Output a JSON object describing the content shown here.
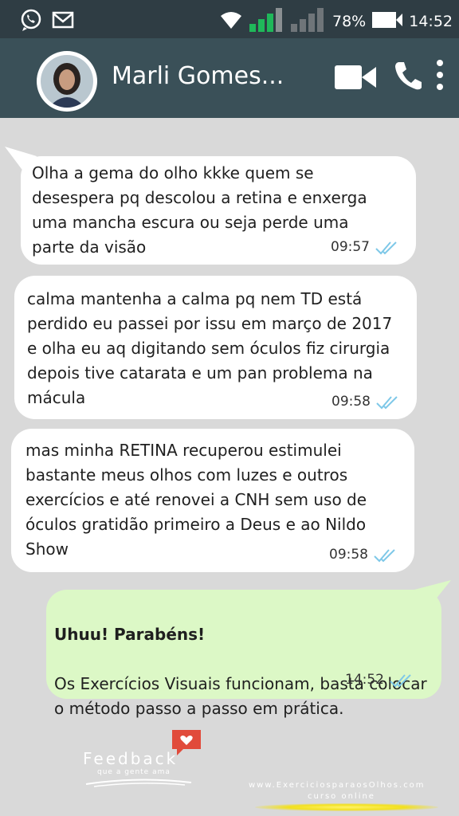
{
  "status_bar": {
    "left_icons": [
      "whatsapp-icon",
      "mail-icon"
    ],
    "battery_percent": "78%",
    "time": "14:52"
  },
  "header": {
    "contact_name": "Marli Gomes...",
    "icons": [
      "video-call-icon",
      "phone-icon",
      "more-vert-icon"
    ]
  },
  "messages": [
    {
      "direction": "incoming",
      "text": "Olha a gema do olho kkke quem se\ndesespera pq descolou a retina e enxerga\numa mancha escura ou seja perde uma\nparte da visão",
      "time": "09:57"
    },
    {
      "direction": "incoming",
      "text": "calma mantenha a calma pq nem TD está\nperdido eu passei por issu em março de 2017\ne olha eu aq digitando sem óculos fiz cirurgia\ndepois tive catarata e um pan problema na\nmácula",
      "time": "09:58"
    },
    {
      "direction": "incoming",
      "text": "mas minha RETINA recuperou estimulei\nbastante meus olhos com luzes e outros\nexercícios e até renovei a CNH sem uso de\nóculos gratidão primeiro a Deus e ao Nildo\nShow",
      "time": "09:58"
    },
    {
      "direction": "outgoing",
      "title": "Uhuu! Parabéns!",
      "text": "Os Exercícios Visuais funcionam, basta colocar\no método passo a passo em prática.",
      "time": "14:52"
    }
  ],
  "footer": {
    "logo_title": "Feedback",
    "logo_subtitle": "que a gente ama",
    "site_url": "www.ExerciciosparaosOlhos.com",
    "site_subtitle": "curso online"
  },
  "colors": {
    "status_bar": "#2f3d44",
    "header": "#3a5058",
    "chat_background": "#d9d9d9",
    "incoming_bubble": "#ffffff",
    "outgoing_bubble": "#dcf8c6",
    "read_ticks": "#7ec8e8",
    "signal_green": "#1fb85a",
    "heart_badge": "#e14b3b"
  }
}
